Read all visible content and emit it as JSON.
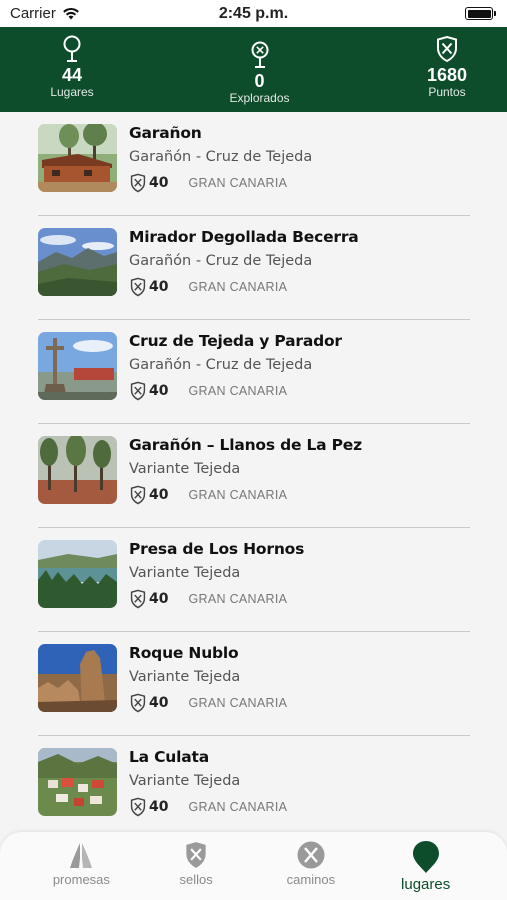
{
  "status_bar": {
    "carrier": "Carrier",
    "time": "2:45 p.m."
  },
  "header": {
    "stats": [
      {
        "value": "44",
        "label": "Lugares",
        "icon": "map-pin-icon"
      },
      {
        "value": "0",
        "label": "Explorados",
        "icon": "explored-pin-icon"
      },
      {
        "value": "1680",
        "label": "Puntos",
        "icon": "shield-crossed-icon"
      }
    ],
    "accent_color": "#0e4d2c"
  },
  "places": [
    {
      "title": "Garañon",
      "route": "Garañón - Cruz de Tejeda",
      "points": "40",
      "region": "GRAN CANARIA",
      "image": "cabin-in-forest"
    },
    {
      "title": "Mirador Degollada Becerra",
      "route": "Garañón - Cruz de Tejeda",
      "points": "40",
      "region": "GRAN CANARIA",
      "image": "mountain-viewpoint"
    },
    {
      "title": "Cruz de Tejeda y Parador",
      "route": "Garañón - Cruz de Tejeda",
      "points": "40",
      "region": "GRAN CANARIA",
      "image": "stone-cross"
    },
    {
      "title": " Garañón – Llanos de La Pez",
      "route": "Variante Tejeda",
      "points": "40",
      "region": "GRAN CANARIA",
      "image": "pine-forest"
    },
    {
      "title": "Presa de Los Hornos",
      "route": "Variante Tejeda",
      "points": "40",
      "region": "GRAN CANARIA",
      "image": "reservoir"
    },
    {
      "title": "Roque Nublo",
      "route": "Variante Tejeda",
      "points": "40",
      "region": "GRAN CANARIA",
      "image": "rock-monolith"
    },
    {
      "title": "La Culata",
      "route": "Variante Tejeda",
      "points": "40",
      "region": "GRAN CANARIA",
      "image": "village-valley"
    }
  ],
  "tabbar": {
    "tabs": [
      {
        "label": "promesas",
        "icon": "praying-hands-icon",
        "active": false
      },
      {
        "label": "sellos",
        "icon": "shield-crossed-icon",
        "active": false
      },
      {
        "label": "caminos",
        "icon": "crossed-tools-circle-icon",
        "active": false
      },
      {
        "label": "lugares",
        "icon": "map-pin-icon",
        "active": true
      }
    ]
  }
}
